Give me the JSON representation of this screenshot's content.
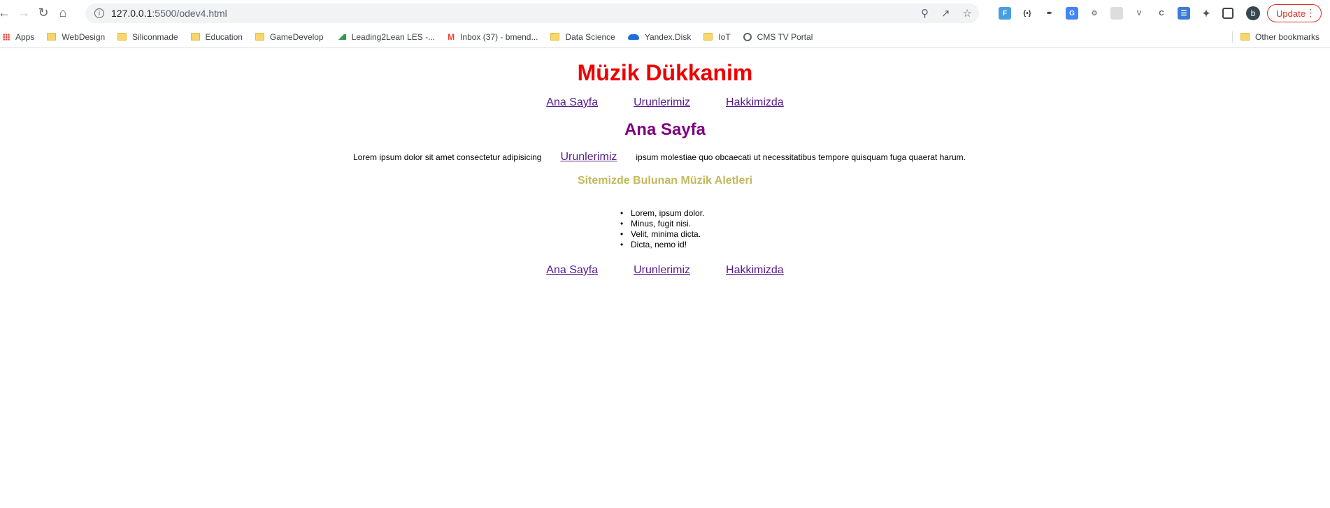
{
  "browser": {
    "url_host": "127.0.0.1",
    "url_rest": ":5500/odev4.html",
    "update_label": "Update",
    "avatar_letter": "b",
    "icons": [
      "back-icon",
      "forward-icon",
      "reload-icon",
      "home-icon",
      "info-icon",
      "zoom-icon",
      "share-icon",
      "star-icon",
      "extensions-icon",
      "sidepanel-icon",
      "more-icon"
    ],
    "accent_color": "#d93025"
  },
  "bookmarks": [
    {
      "label": "Apps",
      "icon": "apps-icon"
    },
    {
      "label": "WebDesign",
      "icon": "folder-icon"
    },
    {
      "label": "Siliconmade",
      "icon": "folder-icon"
    },
    {
      "label": "Education",
      "icon": "folder-icon"
    },
    {
      "label": "GameDevelop",
      "icon": "folder-icon"
    },
    {
      "label": "Leading2Lean LES -...",
      "icon": "l2l-icon"
    },
    {
      "label": "Inbox (37) - bmend...",
      "icon": "gmail-icon"
    },
    {
      "label": "Data Science",
      "icon": "folder-icon"
    },
    {
      "label": "Yandex.Disk",
      "icon": "yandex-icon"
    },
    {
      "label": "IoT",
      "icon": "folder-icon"
    },
    {
      "label": "CMS TV Portal",
      "icon": "globe-icon"
    }
  ],
  "other_bookmarks": "Other bookmarks",
  "page": {
    "title": "Müzik Dükkanim",
    "nav": [
      "Ana Sayfa",
      "Urunlerimiz",
      "Hakkimizda"
    ],
    "heading": "Ana Sayfa",
    "para_before": "Lorem ipsum dolor sit amet consectetur adipisicing",
    "para_link": "Urunlerimiz",
    "para_after": "ipsum molestiae quo obcaecati ut necessitatibus tempore quisquam fuga quaerat harum.",
    "subheading": "Sitemizde Bulunan Müzik Aletleri",
    "list": [
      "Lorem, ipsum dolor.",
      "Minus, fugit nisi.",
      "Velit, minima dicta.",
      "Dicta, nemo id!"
    ],
    "footer_nav": [
      "Ana Sayfa",
      "Urunlerimiz",
      "Hakkimizda"
    ],
    "colors": {
      "title": "#ee0000",
      "heading": "#800080",
      "subheading": "#c2b95a",
      "link": "#551a8b"
    }
  }
}
